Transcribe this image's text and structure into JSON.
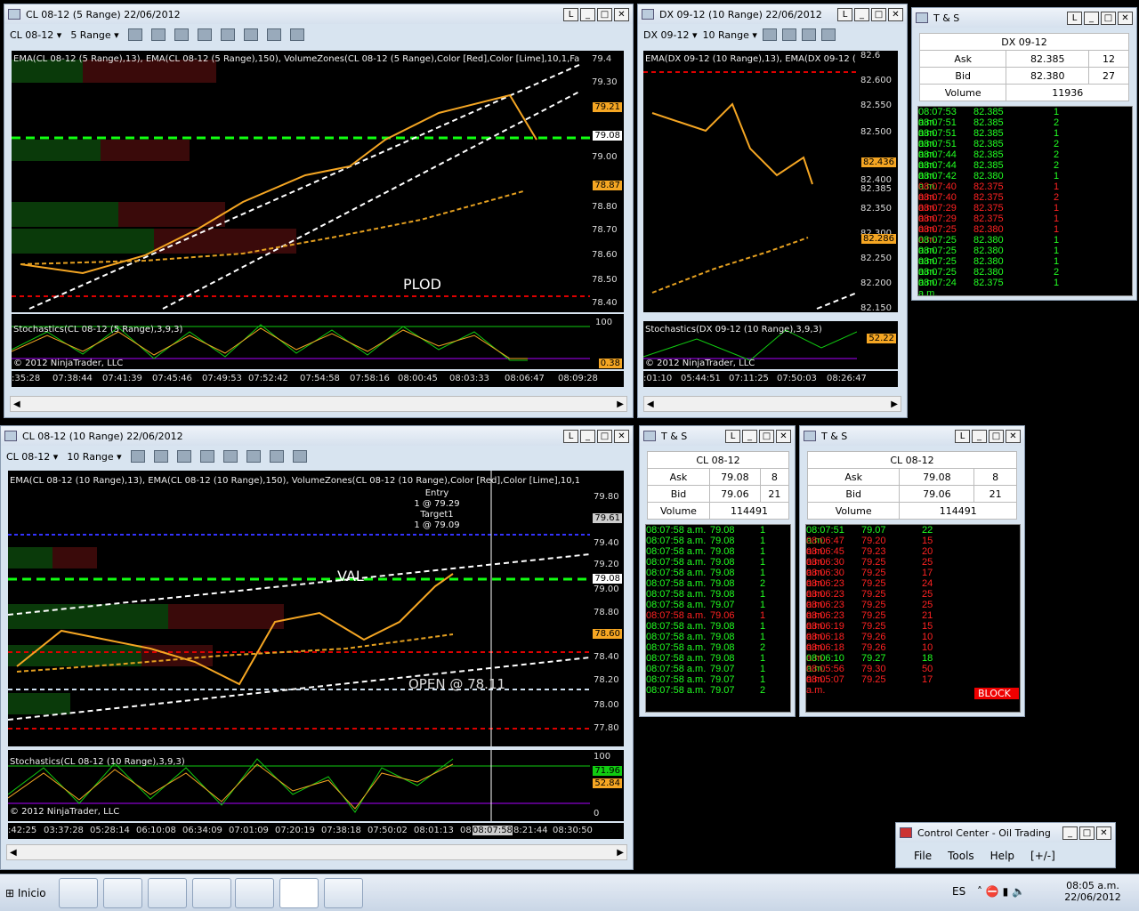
{
  "w1": {
    "title": "CL 08-12 (5 Range)  22/06/2012",
    "instr": "CL 08-12",
    "period": "5 Range",
    "legend": "EMA(CL 08-12 (5 Range),13), EMA(CL 08-12 (5 Range),150), VolumeZones(CL 08-12 (5 Range),Color [Red],Color [Lime],10,1,Fa",
    "stoch": "Stochastics(CL 08-12 (5 Range),3,9,3)",
    "copy": "© 2012 NinjaTrader, LLC",
    "label": "PLOD",
    "ticks": [
      "79.30",
      "79.21",
      "79.08",
      "79.00",
      "78.87",
      "78.80",
      "78.70",
      "78.60",
      "78.50",
      "78.40"
    ],
    "tick_top": "79.4",
    "stoch_ticks": [
      "100",
      "0.38"
    ],
    "times": [
      ":35:28",
      "07:38:44",
      "07:41:39",
      "07:45:46",
      "07:49:53",
      "07:52:42",
      "07:54:58",
      "07:58:16",
      "08:00:45",
      "08:03:33",
      "08:06:47",
      "08:09:28"
    ]
  },
  "w2": {
    "title": "DX 09-12 (10 Range)  22/06/2012",
    "instr": "DX 09-12",
    "period": "10 Range",
    "legend": "EMA(DX 09-12 (10 Range),13), EMA(DX 09-12 (",
    "stoch": "Stochastics(DX 09-12 (10 Range),3,9,3)",
    "copy": "© 2012 NinjaTrader, LLC",
    "ticks": [
      "82.6",
      "82.600",
      "82.550",
      "82.500",
      "82.436",
      "82.400",
      "82.385",
      "82.350",
      "82.300",
      "82.286",
      "82.250",
      "82.200",
      "82.150"
    ],
    "stoch_tag": "52.22",
    "times": [
      ":01:10",
      "05:44:51",
      "07:11:25",
      "07:50:03",
      "08:26:47"
    ]
  },
  "w3": {
    "title": "CL 08-12 (10 Range)  22/06/2012",
    "instr": "CL 08-12",
    "period": "10 Range",
    "legend": "EMA(CL 08-12 (10 Range),13), EMA(CL 08-12 (10 Range),150), VolumeZones(CL 08-12 (10 Range),Color [Red],Color [Lime],10,1,F",
    "stoch": "Stochastics(CL 08-12 (10 Range),3,9,3)",
    "copy": "© 2012 NinjaTrader, LLC",
    "entry": [
      "Entry",
      "1 @ 79.29",
      "Target1",
      "1 @ 79.09"
    ],
    "val": "VAL",
    "open": "OPEN @ 78.11",
    "ticks": [
      "79.80",
      "79.61",
      "79.40",
      "79.20",
      "79.08",
      "79.00",
      "78.80",
      "78.60",
      "78.40",
      "78.20",
      "78.00",
      "77.80"
    ],
    "stoch_ticks": [
      "100",
      "71.96",
      "52.84",
      "0"
    ],
    "times": [
      ":42:25",
      "03:37:28",
      "05:28:14",
      "06:10:08",
      "06:34:09",
      "07:01:09",
      "07:20:19",
      "07:38:18",
      "07:50:02",
      "08:01:13",
      "08",
      "08:07:58",
      "8:21:44",
      "08:30:50"
    ]
  },
  "ts1": {
    "title": "T & S",
    "instr": "DX 09-12",
    "ask": "Ask",
    "ask_p": "82.385",
    "ask_s": "12",
    "bid": "Bid",
    "bid_p": "82.380",
    "bid_s": "27",
    "vol": "Volume",
    "vol_v": "11936",
    "rows": [
      [
        "08:07:53 a.m.",
        "82.385",
        "1",
        "g"
      ],
      [
        "08:07:51 a.m.",
        "82.385",
        "2",
        "g"
      ],
      [
        "08:07:51 a.m.",
        "82.385",
        "1",
        "g"
      ],
      [
        "08:07:51 a.m.",
        "82.385",
        "2",
        "g"
      ],
      [
        "08:07:44 a.m.",
        "82.385",
        "2",
        "g"
      ],
      [
        "08:07:44 a.m.",
        "82.385",
        "2",
        "g"
      ],
      [
        "08:07:42 a.m.",
        "82.380",
        "1",
        "g"
      ],
      [
        "08:07:40 a.m.",
        "82.375",
        "1",
        "r"
      ],
      [
        "08:07:40 a.m.",
        "82.375",
        "2",
        "r"
      ],
      [
        "08:07:29 a.m.",
        "82.375",
        "1",
        "r"
      ],
      [
        "08:07:29 a.m.",
        "82.375",
        "1",
        "r"
      ],
      [
        "08:07:25 a.m.",
        "82.380",
        "1",
        "r"
      ],
      [
        "08:07:25 a.m.",
        "82.380",
        "1",
        "g"
      ],
      [
        "08:07:25 a.m.",
        "82.380",
        "1",
        "g"
      ],
      [
        "08:07:25 a.m.",
        "82.380",
        "1",
        "g"
      ],
      [
        "08:07:25 a.m.",
        "82.380",
        "2",
        "g"
      ],
      [
        "08:07:24 a.m.",
        "82.375",
        "1",
        "g"
      ]
    ]
  },
  "ts2": {
    "title": "T & S",
    "instr": "CL 08-12",
    "ask": "Ask",
    "ask_p": "79.08",
    "ask_s": "8",
    "bid": "Bid",
    "bid_p": "79.06",
    "bid_s": "21",
    "vol": "Volume",
    "vol_v": "114491",
    "rows": [
      [
        "08:07:58 a.m.",
        "79.08",
        "1",
        "g"
      ],
      [
        "08:07:58 a.m.",
        "79.08",
        "1",
        "g"
      ],
      [
        "08:07:58 a.m.",
        "79.08",
        "1",
        "g"
      ],
      [
        "08:07:58 a.m.",
        "79.08",
        "1",
        "g"
      ],
      [
        "08:07:58 a.m.",
        "79.08",
        "1",
        "g"
      ],
      [
        "08:07:58 a.m.",
        "79.08",
        "2",
        "g"
      ],
      [
        "08:07:58 a.m.",
        "79.08",
        "1",
        "g"
      ],
      [
        "08:07:58 a.m.",
        "79.07",
        "1",
        "g"
      ],
      [
        "08:07:58 a.m.",
        "79.06",
        "1",
        "r"
      ],
      [
        "08:07:58 a.m.",
        "79.08",
        "1",
        "g"
      ],
      [
        "08:07:58 a.m.",
        "79.08",
        "1",
        "g"
      ],
      [
        "08:07:58 a.m.",
        "79.08",
        "2",
        "g"
      ],
      [
        "08:07:58 a.m.",
        "79.08",
        "1",
        "g"
      ],
      [
        "08:07:58 a.m.",
        "79.07",
        "1",
        "g"
      ],
      [
        "08:07:58 a.m.",
        "79.07",
        "1",
        "g"
      ],
      [
        "08:07:58 a.m.",
        "79.07",
        "2",
        "g"
      ]
    ]
  },
  "ts3": {
    "title": "T & S",
    "instr": "CL 08-12",
    "ask": "Ask",
    "ask_p": "79.08",
    "ask_s": "8",
    "bid": "Bid",
    "bid_p": "79.06",
    "bid_s": "21",
    "vol": "Volume",
    "vol_v": "114491",
    "block": "BLOCK",
    "rows": [
      [
        "08:07:51 a.m.",
        "79.07",
        "22",
        "g"
      ],
      [
        "08:06:47 a.m.",
        "79.20",
        "15",
        "r"
      ],
      [
        "08:06:45 a.m.",
        "79.23",
        "20",
        "r"
      ],
      [
        "08:06:30 a.m.",
        "79.25",
        "25",
        "r"
      ],
      [
        "08:06:30 a.m.",
        "79.25",
        "17",
        "r"
      ],
      [
        "08:06:23 a.m.",
        "79.25",
        "24",
        "r"
      ],
      [
        "08:06:23 a.m.",
        "79.25",
        "25",
        "r"
      ],
      [
        "08:06:23 a.m.",
        "79.25",
        "25",
        "r"
      ],
      [
        "08:06:23 a.m.",
        "79.25",
        "21",
        "r"
      ],
      [
        "08:06:19 a.m.",
        "79.25",
        "15",
        "r"
      ],
      [
        "08:06:18 a.m.",
        "79.26",
        "10",
        "r"
      ],
      [
        "08:06:18 a.m.",
        "79.26",
        "10",
        "r"
      ],
      [
        "08:06:10 a.m.",
        "79.27",
        "18",
        "g"
      ],
      [
        "08:05:56 a.m.",
        "79.30",
        "50",
        "r"
      ],
      [
        "08:05:07 a.m.",
        "79.25",
        "17",
        "r"
      ]
    ]
  },
  "cc": {
    "title": "Control Center - Oil Trading",
    "menu": [
      "File",
      "Tools",
      "Help",
      "[+/-]"
    ]
  },
  "taskbar": {
    "start": "Inicio",
    "lang": "ES",
    "time": "08:05 a.m.",
    "date": "22/06/2012"
  }
}
